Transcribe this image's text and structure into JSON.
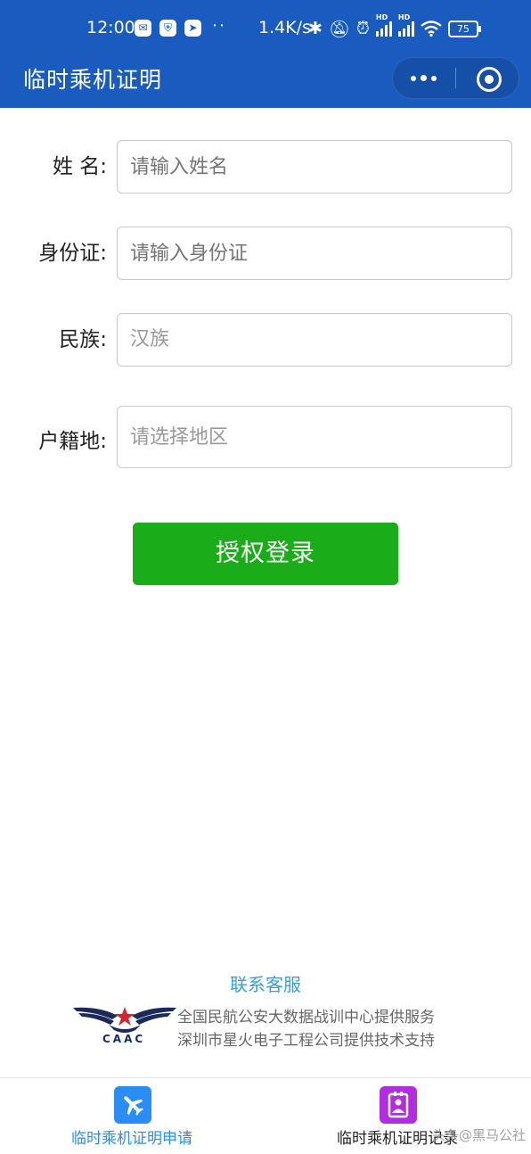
{
  "status_bar": {
    "time": "12:00",
    "dots": "··",
    "network_speed": "1.4K/s",
    "battery": "75",
    "hd_label": "HD"
  },
  "nav": {
    "title": "临时乘机证明"
  },
  "form": {
    "name_label": "姓 名:",
    "name_placeholder": "请输入姓名",
    "id_label": "身份证:",
    "id_placeholder": "请输入身份证",
    "ethnicity_label": "民族:",
    "ethnicity_value": "汉族",
    "domicile_label": "户籍地:",
    "domicile_placeholder": "请选择地区"
  },
  "auth_button": "授权登录",
  "footer": {
    "contact_label": "联系客服",
    "logo_text": "CAAC",
    "provider_line1": "全国民航公安大数据战训中心提供服务",
    "provider_line2": "深圳市星火电子工程公司提供技术支持"
  },
  "tabs": [
    {
      "label": "临时乘机证明申请",
      "icon": "plane-icon",
      "color": "#2a8df3"
    },
    {
      "label": "临时乘机证明记录",
      "icon": "portrait-icon",
      "color": "#b22ddf"
    }
  ],
  "watermark": "头条@黑马公社",
  "colors": {
    "header": "#1a5bbf",
    "primary_button": "#1aad19",
    "contact_link": "#3a9fd6"
  }
}
